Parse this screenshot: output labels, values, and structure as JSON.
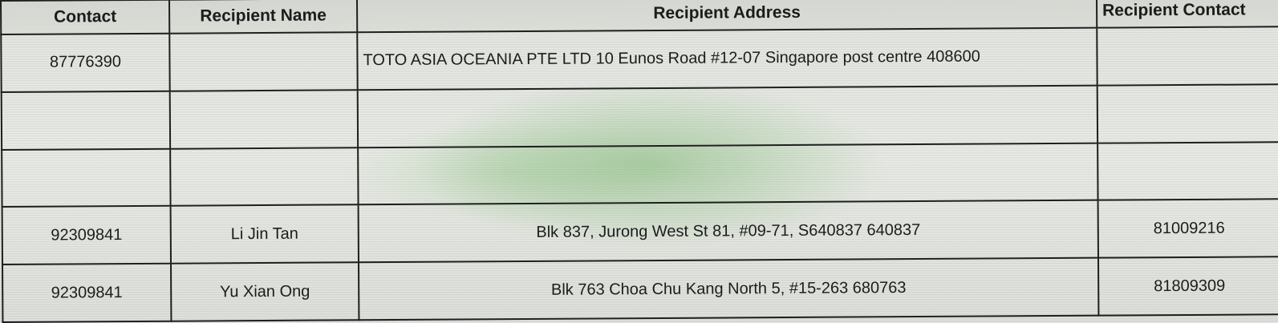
{
  "table": {
    "headers": [
      "Contact",
      "Recipient Name",
      "Recipient Address",
      "Recipient Contact"
    ],
    "rows": [
      {
        "contact": "87776390",
        "name": "",
        "address": "TOTO ASIA OCEANIA PTE LTD 10 Eunos Road #12-07 Singapore post centre 408600",
        "recipient_contact": ""
      },
      {
        "contact": "",
        "name": "",
        "address": "",
        "recipient_contact": ""
      },
      {
        "contact": "",
        "name": "",
        "address": "",
        "recipient_contact": ""
      },
      {
        "contact": "92309841",
        "name": "Li Jin Tan",
        "address": "Blk 837, Jurong West St 81, #09-71, S640837 640837",
        "recipient_contact": "81009216"
      },
      {
        "contact": "92309841",
        "name": "Yu Xian Ong",
        "address": "Blk 763 Choa Chu Kang North 5, #15-263 680763",
        "recipient_contact": "81809309"
      }
    ]
  }
}
